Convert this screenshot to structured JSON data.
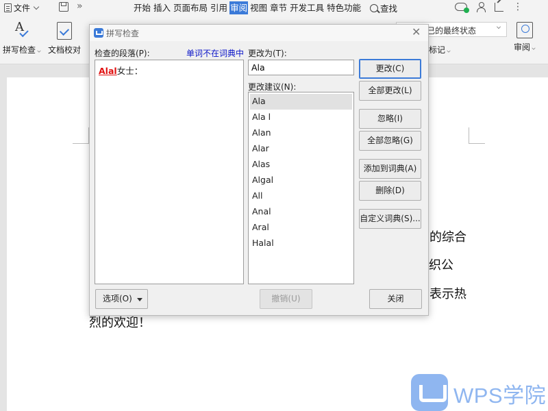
{
  "menubar": {
    "file_label": "文件",
    "tabs": [
      {
        "label": "开始",
        "active": false
      },
      {
        "label": "插入",
        "active": false
      },
      {
        "label": "页面布局",
        "active": false
      },
      {
        "label": "引用",
        "active": false
      },
      {
        "label": "审阅",
        "active": true
      },
      {
        "label": "视图",
        "active": false
      },
      {
        "label": "章节",
        "active": false
      },
      {
        "label": "开发工具",
        "active": false
      },
      {
        "label": "特色功能",
        "active": false
      }
    ],
    "search_label": "查找"
  },
  "ribbon": {
    "spell_check_label": "拼写检查",
    "doc_proof_label": "文档校对",
    "display_state_value": "己的最终状态",
    "markup_label": "标记",
    "review_label": "审阅"
  },
  "document": {
    "line1_tail": "的综合",
    "line2_tail": "织公",
    "line3_tail": "表示热",
    "line4": "烈的欢迎！"
  },
  "dialog": {
    "title": "拼写检查",
    "paragraph_label": "检查的段落(P):",
    "not_in_dict_label": "单词不在词典中",
    "paragraph_error_word": "Alal",
    "paragraph_rest": "女士：",
    "change_to_label": "更改为(T):",
    "change_to_value": "Ala",
    "suggestions_label": "更改建议(N):",
    "suggestions": [
      "Ala",
      "Ala l",
      "Alan",
      "Alar",
      "Alas",
      "Algal",
      "All",
      "Anal",
      "Aral",
      "Halal"
    ],
    "selected_suggestion": "Ala",
    "buttons": {
      "change": "更改(C)",
      "change_all": "全部更改(L)",
      "ignore": "忽略(I)",
      "ignore_all": "全部忽略(G)",
      "add_to_dict": "添加到词典(A)",
      "delete": "删除(D)",
      "custom_dict": "自定义词典(S)...",
      "options": "选项(O)",
      "undo": "撤销(U)",
      "close": "关闭"
    }
  },
  "watermark": {
    "text": "WPS学院",
    "color": "#8fb6f0"
  },
  "colors": {
    "accent": "#3b7ad8",
    "error_word": "#e01010",
    "not_in_dict": "#0a14c8"
  }
}
